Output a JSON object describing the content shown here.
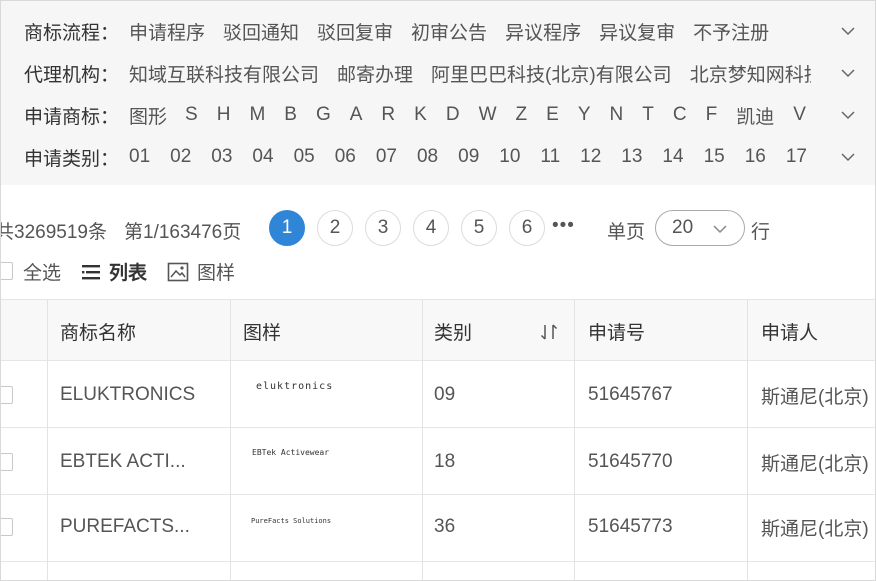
{
  "filters": [
    {
      "label": "商标流程：",
      "options": [
        "申请程序",
        "驳回通知",
        "驳回复审",
        "初审公告",
        "异议程序",
        "异议复审",
        "不予注册"
      ]
    },
    {
      "label": "代理机构：",
      "options": [
        "知域互联科技有限公司",
        "邮寄办理",
        "阿里巴巴科技(北京)有限公司",
        "北京梦知网科技有限公司"
      ]
    },
    {
      "label": "申请商标：",
      "options": [
        "图形",
        "S",
        "H",
        "M",
        "B",
        "G",
        "A",
        "R",
        "K",
        "D",
        "W",
        "Z",
        "E",
        "Y",
        "N",
        "T",
        "C",
        "F",
        "凯迪",
        "V"
      ]
    },
    {
      "label": "申请类别：",
      "options": [
        "01",
        "02",
        "03",
        "04",
        "05",
        "06",
        "07",
        "08",
        "09",
        "10",
        "11",
        "12",
        "13",
        "14",
        "15",
        "16",
        "17"
      ]
    }
  ],
  "pagination": {
    "total": "共3269519条",
    "page_info": "第1/163476页",
    "pages": [
      "1",
      "2",
      "3",
      "4",
      "5",
      "6"
    ],
    "active_page": "1",
    "ellipsis": "•••",
    "per_page_label": "单页",
    "per_page_value": "20",
    "per_page_unit": "行"
  },
  "toolbar": {
    "select_all": "全选",
    "list_view": "列表",
    "image_view": "图样"
  },
  "table": {
    "columns": [
      "商标名称",
      "图样",
      "类别",
      "申请号",
      "申请人"
    ],
    "rows": [
      {
        "name": "ELUKTRONICS",
        "sample": "eluktronics",
        "class": "09",
        "app_no": "51645767",
        "applicant": "斯通尼(北京)"
      },
      {
        "name": "EBTEK ACTI...",
        "sample": "EBTek Activewear",
        "class": "18",
        "app_no": "51645770",
        "applicant": "斯通尼(北京)"
      },
      {
        "name": "PUREFACTS...",
        "sample": "PureFacts Solutions",
        "class": "36",
        "app_no": "51645773",
        "applicant": "斯通尼(北京)"
      }
    ]
  },
  "colors": {
    "accent": "#2f86d6",
    "filter_bg": "#f6f6f6",
    "header_bg": "#f8f8f8"
  },
  "icons": [
    "chevron-down-icon",
    "list-icon",
    "image-icon",
    "sort-icon"
  ]
}
